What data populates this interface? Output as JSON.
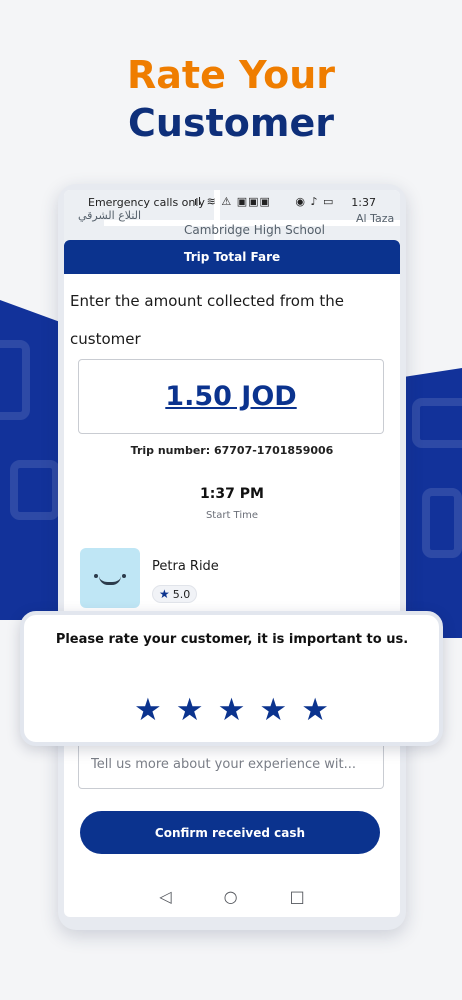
{
  "headline": {
    "line1": "Rate Your",
    "line2": "Customer"
  },
  "status_bar": {
    "carrier": "Emergency calls only",
    "time": "1:37",
    "icons": [
      "signal-icon",
      "wifi-icon",
      "alert-icon",
      "app-icons",
      "location-icon",
      "mute-icon",
      "battery-icon"
    ]
  },
  "map": {
    "labels": [
      "Cambridge High School",
      "التلاع الشرقي",
      "Al Taza"
    ]
  },
  "sheet": {
    "title": "Trip Total Fare",
    "instruction": "Enter the amount collected from the customer",
    "amount": "1.50 JOD",
    "trip_number": "Trip number: 67707-1701859006",
    "start_time": "1:37 PM",
    "start_time_label": "Start Time"
  },
  "customer": {
    "name": "Petra Ride",
    "rating": "5.0"
  },
  "rate_card": {
    "prompt": "Please rate your customer, it is important to us.",
    "stars_selected": 5,
    "stars_total": 5
  },
  "comment": {
    "placeholder": "Tell us more about your experience wit..."
  },
  "confirm_button": {
    "label": "Confirm received cash"
  },
  "colors": {
    "primary": "#0b338e",
    "accent": "#ef7d00"
  }
}
